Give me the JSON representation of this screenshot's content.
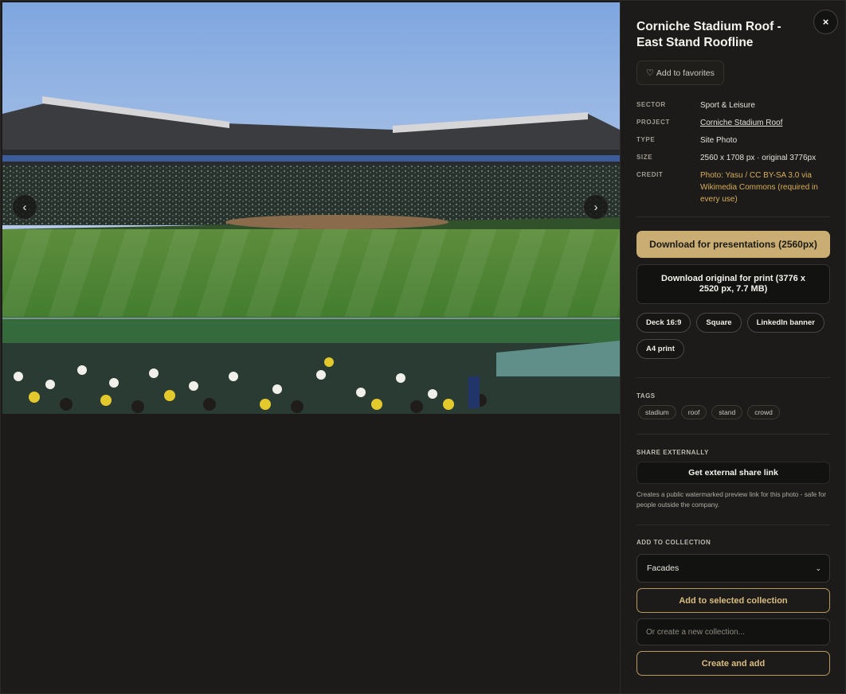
{
  "photo": {
    "alt": "Corniche Stadium Roof - East Stand Roofline",
    "prev_label": "‹",
    "next_label": "›"
  },
  "panel": {
    "close_label": "×",
    "title": "Corniche Stadium Roof - East Stand Roofline",
    "favorite_label": "Add to favorites",
    "meta": {
      "sector_key": "SECTOR",
      "sector_val": "Sport & Leisure",
      "project_key": "PROJECT",
      "project_val": "Corniche Stadium Roof",
      "type_key": "TYPE",
      "type_val": "Site Photo",
      "size_key": "SIZE",
      "size_val": "2560 x 1708 px · original 3776px",
      "credit_key": "CREDIT",
      "credit_val": "Photo: Yasu / CC BY-SA 3.0 via Wikimedia Commons (required in every use)"
    },
    "download_presentation": "Download for presentations (2560px)",
    "download_original": "Download original for print (3776 x 2520 px, 7.7 MB)",
    "formats": [
      "Deck 16:9",
      "Square",
      "LinkedIn banner",
      "A4 print"
    ],
    "tags_label": "TAGS",
    "tags": [
      "stadium",
      "roof",
      "stand",
      "crowd"
    ],
    "share_label": "SHARE EXTERNALLY",
    "share_button": "Get external share link",
    "share_note": "Creates a public watermarked preview link for this photo - safe for people outside the company.",
    "collection_label": "ADD TO COLLECTION",
    "collection_selected": "Facades",
    "add_selected_button": "Add to selected collection",
    "new_collection_placeholder": "Or create a new collection...",
    "create_add_button": "Create and add"
  },
  "colors": {
    "accent_gold": "#c9ad72",
    "credit_gold": "#d7ad58",
    "panel_bg": "#1c1b19"
  },
  "icons": {
    "close": "close-icon",
    "favorite": "heart-icon",
    "prev": "chevron-left-icon",
    "next": "chevron-right-icon",
    "select": "chevron-down-icon"
  }
}
